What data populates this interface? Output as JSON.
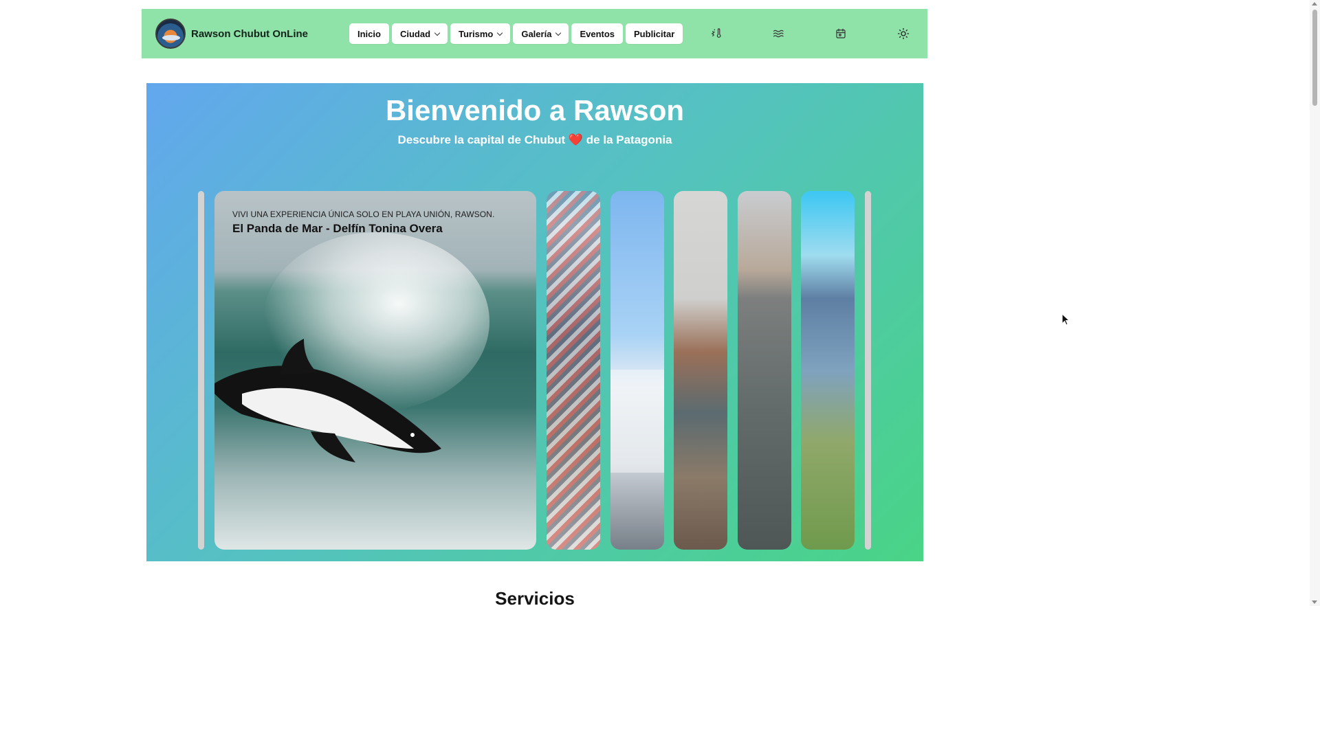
{
  "header": {
    "brand_name": "Rawson Chubut OnLine",
    "background": "#8fe3a9",
    "nav": [
      {
        "label": "Inicio",
        "has_dropdown": false
      },
      {
        "label": "Ciudad",
        "has_dropdown": true
      },
      {
        "label": "Turismo",
        "has_dropdown": true
      },
      {
        "label": "Galería",
        "has_dropdown": true
      },
      {
        "label": "Eventos",
        "has_dropdown": false
      },
      {
        "label": "Publicitar",
        "has_dropdown": false
      }
    ],
    "icons": [
      "weather-icon",
      "tide-waves-icon",
      "calendar-icon",
      "theme-sun-icon"
    ]
  },
  "hero": {
    "title": "Bienvenido a Rawson",
    "subtitle": "Descubre la capital de Chubut ❤️ de la Patagonia",
    "featured": {
      "kicker": "VIVI UNA EXPERIENCIA ÚNICA SOLO EN PLAYA UNIÓN, RAWSON.",
      "title": "El Panda de Mar - Delfín Tonina Overa"
    },
    "gradient": [
      "#62a7ee",
      "#55c1c2",
      "#49d486"
    ]
  },
  "sections": {
    "services_title": "Servicios"
  }
}
